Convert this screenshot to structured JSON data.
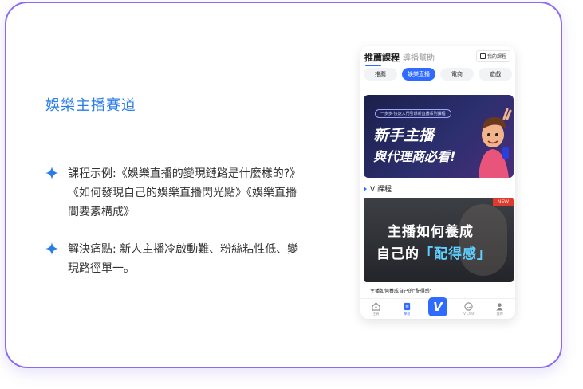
{
  "slide": {
    "title": "娛樂主播賽道",
    "bullets": [
      {
        "text": "課程示例:《娛樂直播的變現鏈路是什麼樣的?》《如何發現自己的娛樂直播閃光點》《娛樂直播間要素構成》"
      },
      {
        "text": "解決痛點: 新人主播冷啟動難、粉絲粘性低、變現路徑單一。"
      }
    ]
  },
  "phone": {
    "tab_active": "推薦課程",
    "tab_inactive": "導播幫助",
    "my_course": "我的課程",
    "chips": [
      "推薦",
      "娛樂直播",
      "電商",
      "遊戲"
    ],
    "active_chip_index": 1,
    "banner": {
      "pill": "一步步·快速入門引爆新直播系列課程",
      "line1": "新手主播",
      "line2": "與代理商必看!"
    },
    "section_label": "V 課程",
    "course": {
      "badge": "NEW",
      "line1": "主播如何養成",
      "line2_prefix": "自己的",
      "line2_highlight": "「配得感」",
      "caption": "主播如何養成自己的\"配得感\""
    },
    "nav": [
      {
        "label": "主頁",
        "icon": "home-icon"
      },
      {
        "label": "學習",
        "icon": "book-icon"
      },
      {
        "label": "V",
        "icon": "v-logo-icon"
      },
      {
        "label": "V Chat",
        "icon": "chat-icon"
      },
      {
        "label": "我的",
        "icon": "user-icon"
      }
    ],
    "accent": "#2f6bff"
  }
}
